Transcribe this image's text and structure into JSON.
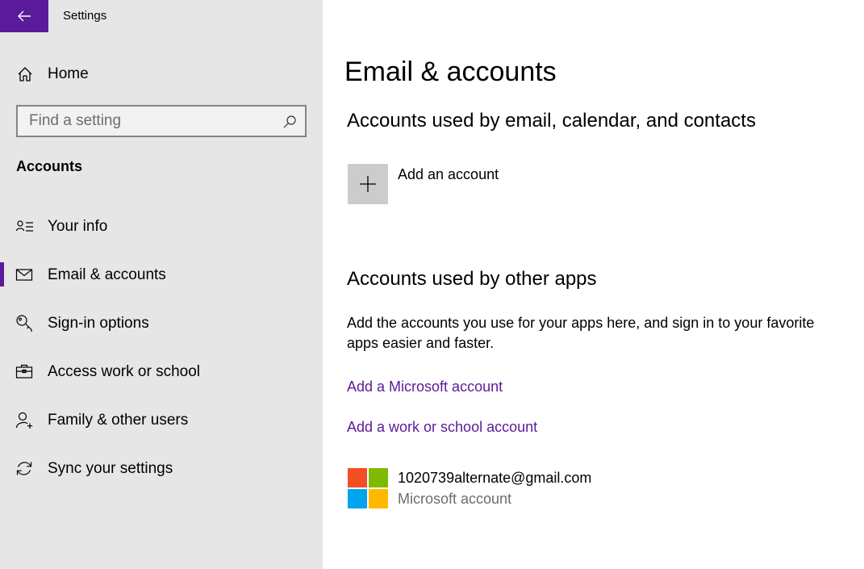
{
  "window": {
    "title": "Settings",
    "back_icon": "back-arrow-icon",
    "accent_color": "#5b1a9a"
  },
  "sidebar": {
    "home_label": "Home",
    "home_icon": "home-icon",
    "search": {
      "placeholder": "Find a setting",
      "value": "",
      "icon": "search-icon"
    },
    "section_heading": "Accounts",
    "items": [
      {
        "label": "Your info",
        "icon": "person-card-icon",
        "selected": false
      },
      {
        "label": "Email & accounts",
        "icon": "mail-icon",
        "selected": true
      },
      {
        "label": "Sign-in options",
        "icon": "key-icon",
        "selected": false
      },
      {
        "label": "Access work or school",
        "icon": "briefcase-icon",
        "selected": false
      },
      {
        "label": "Family & other users",
        "icon": "add-person-icon",
        "selected": false
      },
      {
        "label": "Sync your settings",
        "icon": "sync-icon",
        "selected": false
      }
    ]
  },
  "main": {
    "title": "Email & accounts",
    "email_section": {
      "heading": "Accounts used by email, calendar, and contacts",
      "add_account_label": "Add an account",
      "add_icon": "plus-icon"
    },
    "apps_section": {
      "heading": "Accounts used by other apps",
      "description": "Add the accounts you use for your apps here, and sign in to your favorite apps easier and faster.",
      "add_microsoft_link": "Add a Microsoft account",
      "add_work_link": "Add a work or school account",
      "accounts": [
        {
          "email": "1020739alternate@gmail.com",
          "type": "Microsoft account",
          "icon": "microsoft-logo-icon",
          "logo_colors": [
            "#f25022",
            "#7fba00",
            "#00a4ef",
            "#ffb900"
          ]
        }
      ]
    }
  }
}
